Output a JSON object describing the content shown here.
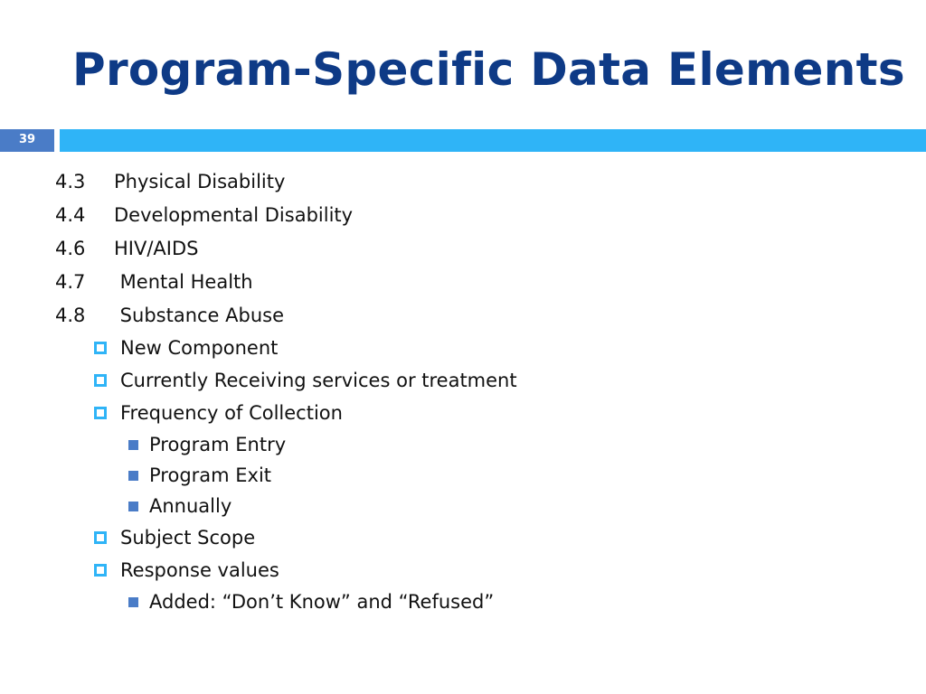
{
  "slide": {
    "title": "Program-Specific Data Elements",
    "number": "39",
    "colors": {
      "title": "#0E3A86",
      "accent_bar": "#2FB4F7",
      "number_box": "#4A7CC7"
    }
  },
  "items": [
    {
      "num": "4.3",
      "label": "Physical Disability"
    },
    {
      "num": "4.4",
      "label": "Developmental Disability"
    },
    {
      "num": "4.6",
      "label": "HIV/AIDS"
    },
    {
      "num": "4.7",
      "label": " Mental Health"
    },
    {
      "num": "4.8",
      "label": " Substance Abuse"
    }
  ],
  "bullets": [
    {
      "label": "New Component"
    },
    {
      "label": "Currently Receiving services or treatment"
    },
    {
      "label": "Frequency of Collection",
      "sub": [
        "Program Entry",
        "Program Exit",
        "Annually"
      ]
    },
    {
      "label": "Subject Scope"
    },
    {
      "label": "Response values",
      "sub": [
        "Added: “Don’t Know” and “Refused”"
      ]
    }
  ]
}
